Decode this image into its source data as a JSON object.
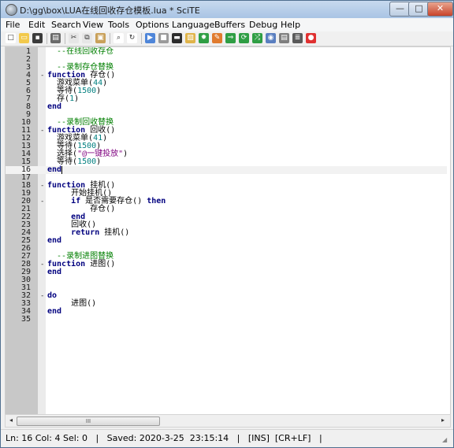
{
  "window": {
    "title": "D:\\gg\\box\\LUA在线回收存仓模板.lua * SciTE",
    "minimize": "—",
    "maximize": "□",
    "close": "✕"
  },
  "menu": [
    "File",
    "Edit",
    "Search",
    "View",
    "Tools",
    "Options",
    "Language",
    "Buffers",
    "Debug",
    "Help"
  ],
  "toolbar": [
    {
      "name": "new-file-icon",
      "glyph": "□",
      "color": "#ffffff"
    },
    {
      "name": "open-folder-icon",
      "glyph": "▭",
      "color": "#f2c94c"
    },
    {
      "name": "save-icon",
      "glyph": "▪",
      "color": "#3b3b3b"
    },
    {
      "name": "print-icon",
      "glyph": "▤",
      "color": "#6a6a6a"
    },
    {
      "name": "cut-icon",
      "glyph": "✂",
      "color": "#e6e6e6"
    },
    {
      "name": "copy-icon",
      "glyph": "⧉",
      "color": "#e6e6e6"
    },
    {
      "name": "paste-icon",
      "glyph": "▣",
      "color": "#c9a15a"
    },
    {
      "name": "find-icon",
      "glyph": "⌕",
      "color": "#ffffff"
    },
    {
      "name": "replace-icon",
      "glyph": "↻",
      "color": "#ffffff"
    },
    {
      "name": "run-icon",
      "glyph": "▶",
      "color": "#4f86d9"
    },
    {
      "name": "stop-icon",
      "glyph": "■",
      "color": "#9a9a9a"
    },
    {
      "name": "terminal-icon",
      "glyph": "▬",
      "color": "#2d2d2d"
    },
    {
      "name": "build-icon",
      "glyph": "▧",
      "color": "#e0b44a"
    },
    {
      "name": "gear-icon",
      "glyph": "✹",
      "color": "#2f9e44"
    },
    {
      "name": "paint-icon",
      "glyph": "✎",
      "color": "#e07b2e"
    },
    {
      "name": "arrow-right-icon",
      "glyph": "⇒",
      "color": "#2f9e44"
    },
    {
      "name": "recycle-icon",
      "glyph": "⟳",
      "color": "#2f9e44"
    },
    {
      "name": "shuffle-icon",
      "glyph": "⤮",
      "color": "#2f9e44"
    },
    {
      "name": "eye-icon",
      "glyph": "◉",
      "color": "#5a7fc0"
    },
    {
      "name": "document-icon",
      "glyph": "▤",
      "color": "#7f7f7f"
    },
    {
      "name": "list-icon",
      "glyph": "≣",
      "color": "#5a5a5a"
    },
    {
      "name": "record-icon",
      "glyph": "●",
      "color": "#e03131"
    }
  ],
  "editor": {
    "current_line": 16,
    "lines": [
      {
        "n": "1",
        "fold": "",
        "tokens": [
          {
            "t": "  --在线回收存仓",
            "c": "cm"
          }
        ]
      },
      {
        "n": "2",
        "fold": "",
        "tokens": []
      },
      {
        "n": "3",
        "fold": "",
        "tokens": [
          {
            "t": "  --录制存仓替换",
            "c": "cm"
          }
        ]
      },
      {
        "n": "4",
        "fold": "-",
        "tokens": [
          {
            "t": "function",
            "c": "kw"
          },
          {
            "t": " 存仓()",
            "c": "id"
          }
        ]
      },
      {
        "n": "5",
        "fold": "",
        "tokens": [
          {
            "t": "  游戏菜单(",
            "c": "id"
          },
          {
            "t": "44",
            "c": "num"
          },
          {
            "t": ")",
            "c": "id"
          }
        ]
      },
      {
        "n": "6",
        "fold": "",
        "tokens": [
          {
            "t": "  等待(",
            "c": "id"
          },
          {
            "t": "1500",
            "c": "num"
          },
          {
            "t": ")",
            "c": "id"
          }
        ]
      },
      {
        "n": "7",
        "fold": "",
        "tokens": [
          {
            "t": "  存(",
            "c": "id"
          },
          {
            "t": "1",
            "c": "num"
          },
          {
            "t": ")",
            "c": "id"
          }
        ]
      },
      {
        "n": "8",
        "fold": "",
        "tokens": [
          {
            "t": "end",
            "c": "kw"
          }
        ]
      },
      {
        "n": "9",
        "fold": "",
        "tokens": []
      },
      {
        "n": "10",
        "fold": "",
        "tokens": [
          {
            "t": "  --录制回收替换",
            "c": "cm"
          }
        ]
      },
      {
        "n": "11",
        "fold": "-",
        "tokens": [
          {
            "t": "function",
            "c": "kw"
          },
          {
            "t": " 回收()",
            "c": "id"
          }
        ]
      },
      {
        "n": "12",
        "fold": "",
        "tokens": [
          {
            "t": "  游戏菜单(",
            "c": "id"
          },
          {
            "t": "41",
            "c": "num"
          },
          {
            "t": ")",
            "c": "id"
          }
        ]
      },
      {
        "n": "13",
        "fold": "",
        "tokens": [
          {
            "t": "  等待(",
            "c": "id"
          },
          {
            "t": "1500",
            "c": "num"
          },
          {
            "t": ")",
            "c": "id"
          }
        ]
      },
      {
        "n": "14",
        "fold": "",
        "tokens": [
          {
            "t": "  选择(",
            "c": "id"
          },
          {
            "t": "\"@一键投放\"",
            "c": "str"
          },
          {
            "t": ")",
            "c": "id"
          }
        ]
      },
      {
        "n": "15",
        "fold": "",
        "tokens": [
          {
            "t": "  等待(",
            "c": "id"
          },
          {
            "t": "1500",
            "c": "num"
          },
          {
            "t": ")",
            "c": "id"
          }
        ]
      },
      {
        "n": "16",
        "fold": "",
        "tokens": [
          {
            "t": "end",
            "c": "kw"
          }
        ]
      },
      {
        "n": "17",
        "fold": "",
        "tokens": []
      },
      {
        "n": "18",
        "fold": "-",
        "tokens": [
          {
            "t": "function",
            "c": "kw"
          },
          {
            "t": " 挂机()",
            "c": "id"
          }
        ]
      },
      {
        "n": "19",
        "fold": "",
        "tokens": [
          {
            "t": "     开始挂机()",
            "c": "id"
          }
        ]
      },
      {
        "n": "20",
        "fold": "-",
        "tokens": [
          {
            "t": "     ",
            "c": "id"
          },
          {
            "t": "if",
            "c": "kw"
          },
          {
            "t": " 是否需要存仓() ",
            "c": "id"
          },
          {
            "t": "then",
            "c": "kw"
          }
        ]
      },
      {
        "n": "21",
        "fold": "",
        "tokens": [
          {
            "t": "         存仓()",
            "c": "id"
          }
        ]
      },
      {
        "n": "22",
        "fold": "",
        "tokens": [
          {
            "t": "     ",
            "c": "id"
          },
          {
            "t": "end",
            "c": "kw"
          }
        ]
      },
      {
        "n": "23",
        "fold": "",
        "tokens": [
          {
            "t": "     回收()",
            "c": "id"
          }
        ]
      },
      {
        "n": "24",
        "fold": "",
        "tokens": [
          {
            "t": "     ",
            "c": "id"
          },
          {
            "t": "return",
            "c": "kw"
          },
          {
            "t": " 挂机()",
            "c": "id"
          }
        ]
      },
      {
        "n": "25",
        "fold": "",
        "tokens": [
          {
            "t": "end",
            "c": "kw"
          }
        ]
      },
      {
        "n": "26",
        "fold": "",
        "tokens": []
      },
      {
        "n": "27",
        "fold": "",
        "tokens": [
          {
            "t": "  --录制进图替换",
            "c": "cm"
          }
        ]
      },
      {
        "n": "28",
        "fold": "-",
        "tokens": [
          {
            "t": "function",
            "c": "kw"
          },
          {
            "t": " 进图()",
            "c": "id"
          }
        ]
      },
      {
        "n": "29",
        "fold": "",
        "tokens": [
          {
            "t": "end",
            "c": "kw"
          }
        ]
      },
      {
        "n": "30",
        "fold": "",
        "tokens": []
      },
      {
        "n": "31",
        "fold": "",
        "tokens": []
      },
      {
        "n": "32",
        "fold": "-",
        "tokens": [
          {
            "t": "do",
            "c": "kw"
          }
        ]
      },
      {
        "n": "33",
        "fold": "",
        "tokens": [
          {
            "t": "     进图()",
            "c": "id"
          }
        ]
      },
      {
        "n": "34",
        "fold": "",
        "tokens": [
          {
            "t": "end",
            "c": "kw"
          }
        ]
      },
      {
        "n": "35",
        "fold": "",
        "tokens": []
      }
    ]
  },
  "scrollbar": {
    "left": "◂",
    "right": "▸",
    "thumb": "III"
  },
  "status": "Ln: 16 Col: 4 Sel: 0   |   Saved: 2020-3-25  23:15:14   |   [INS]  [CR+LF]   |"
}
